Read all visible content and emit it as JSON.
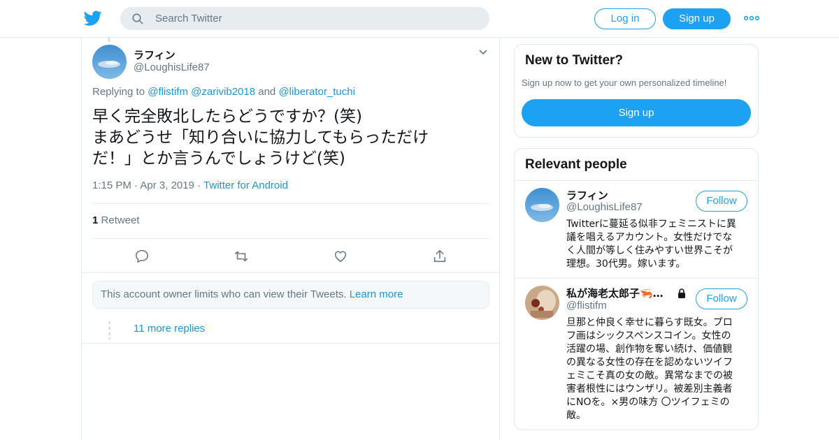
{
  "nav": {
    "search_placeholder": "Search Twitter",
    "login_label": "Log in",
    "signup_label": "Sign up",
    "icons": [
      "twitter-bird-icon",
      "search-icon",
      "more-dots-icon"
    ],
    "accent_color": "#1da1f2"
  },
  "tweet": {
    "author_name": "ラフィン",
    "author_handle": "@LoughisLife87",
    "replying_prefix": "Replying to",
    "replying_to": [
      "@flistifm",
      "@zarivib2018"
    ],
    "replying_and": "and",
    "replying_last": "@liberator_tuchi",
    "text_lines": [
      "早く完全敗北したらどうですか？(笑)",
      "まあどうせ「知り合いに協力してもらっただけ",
      "だ！」とか言うんでしょうけど(笑)"
    ],
    "time": "1:15 PM",
    "date": "Apr 3, 2019",
    "source": "Twitter for Android",
    "retweet_count": "1",
    "retweet_label": "Retweet",
    "actions": [
      "reply-icon",
      "retweet-icon",
      "like-icon",
      "share-icon"
    ]
  },
  "notice": {
    "text": "This account owner limits who can view their Tweets.",
    "link": "Learn more"
  },
  "more_replies": "11 more replies",
  "new_to_twitter": {
    "title": "New to Twitter?",
    "subtitle": "Sign up now to get your own personalized timeline!",
    "button": "Sign up"
  },
  "relevant_people": {
    "title": "Relevant people",
    "people": [
      {
        "name": "ラフィン",
        "handle": "@LoughisLife87",
        "follow": "Follow",
        "bio_lines": [
          "Twitterに蔓延る似非フェミニストに異",
          "議を唱えるアカウント。女性だけでな",
          "く人間が等しく住みやすい世界こそが",
          "理想。30代男。嫁います。"
        ]
      },
      {
        "name": "私が海老太郎子🦐…",
        "handle": "@flistifm",
        "follow": "Follow",
        "protected": true,
        "bio_lines": [
          "旦那と仲良く幸せに暮らす既女。プロ",
          "フ画はシックスペンスコイン。女性の",
          "活躍の場、創作物を奪い続け、価値観",
          "の異なる女性の存在を認めないツイフ",
          "ェミこそ真の女の敵。異常なまでの被",
          "害者根性にはウンザリ。被差別主義者",
          "にNOを。×男の味方 〇ツイフェミの",
          "敵。"
        ]
      }
    ]
  }
}
